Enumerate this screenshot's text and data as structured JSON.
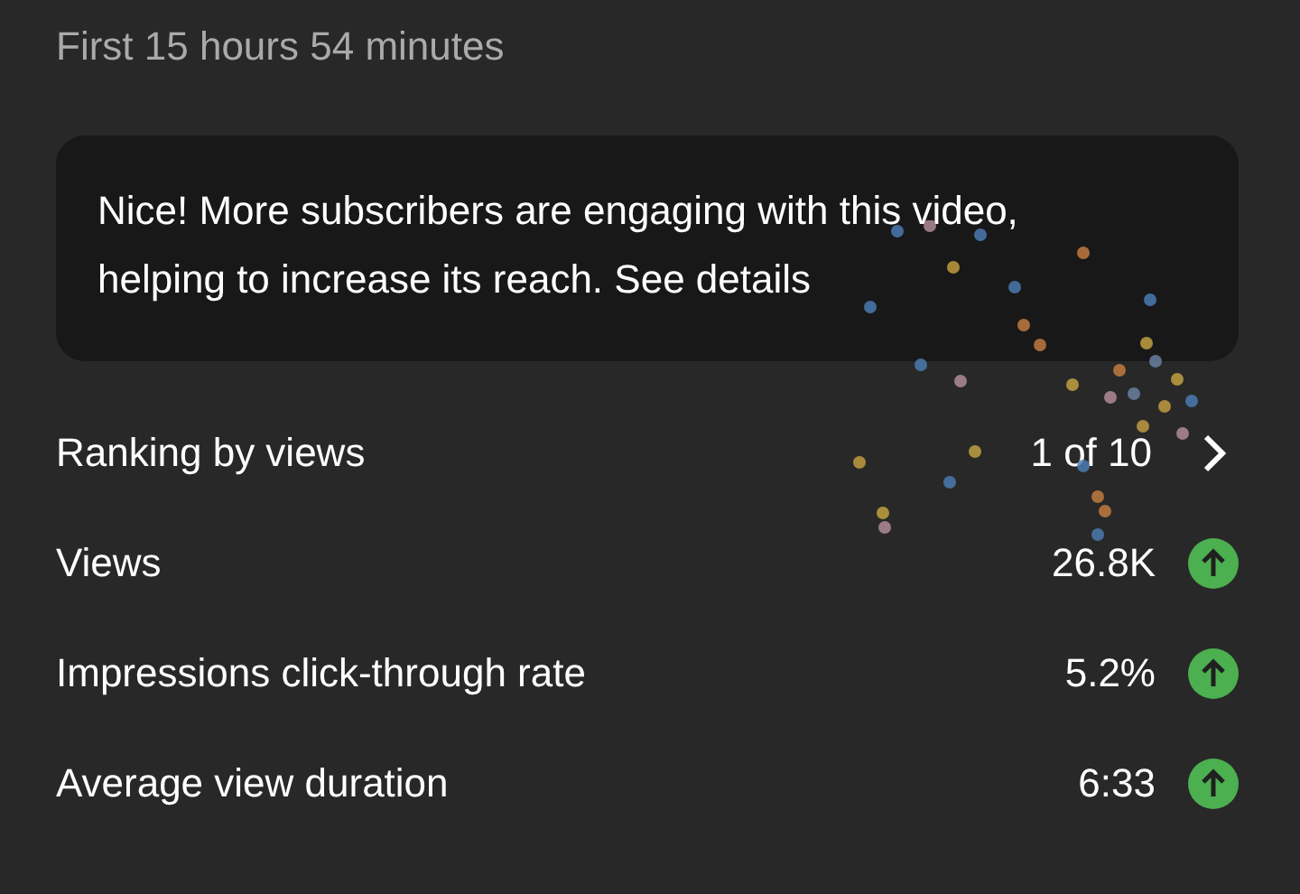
{
  "subtitle": "First 15 hours 54 minutes",
  "insight": {
    "text": "Nice! More subscribers are engaging with this video, helping to increase its reach.",
    "link": "See details"
  },
  "rows": [
    {
      "kind": "ranking",
      "label": "Ranking by views",
      "value": "1 of 10"
    },
    {
      "kind": "metric",
      "label": "Views",
      "value": "26.8K",
      "trending_up": true
    },
    {
      "kind": "metric",
      "label": "Impressions click-through rate",
      "value": "5.2%",
      "trending_up": true
    },
    {
      "kind": "metric",
      "label": "Average view duration",
      "value": "6:33",
      "trending_up": true
    }
  ]
}
